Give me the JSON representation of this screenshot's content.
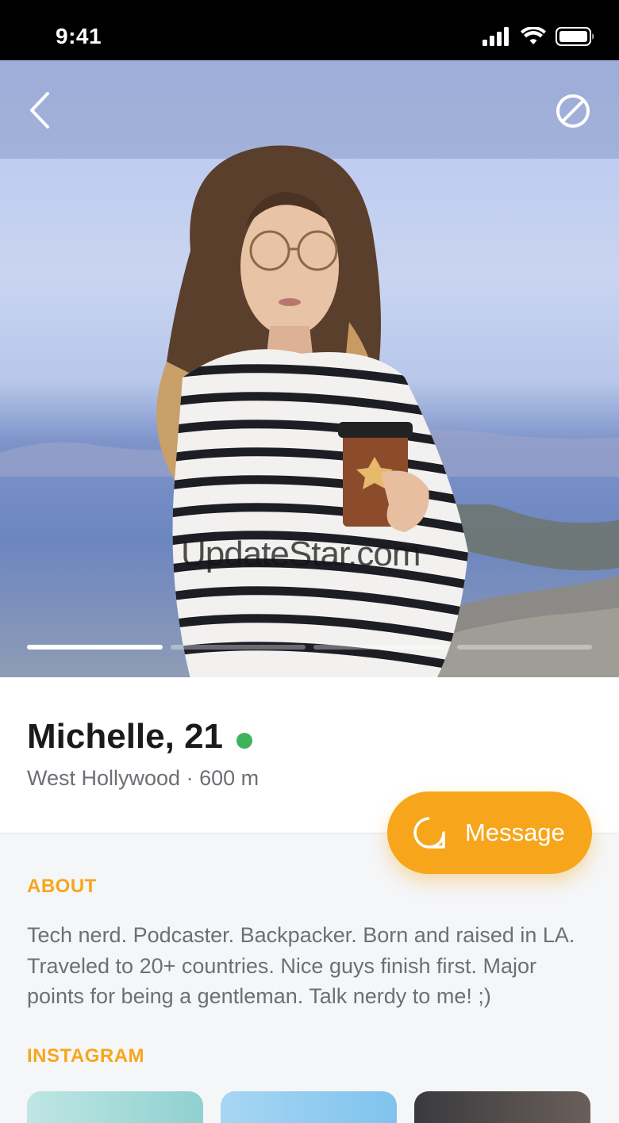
{
  "status_bar": {
    "time": "9:41"
  },
  "photo": {
    "watermark": "UpdateStar.com",
    "page_count": 4,
    "active_page": 1
  },
  "profile": {
    "name": "Michelle, 21",
    "location": "West Hollywood · 600 m",
    "online": true
  },
  "actions": {
    "message_label": "Message"
  },
  "about": {
    "title": "ABOUT",
    "text": "Tech nerd. Podcaster. Backpacker. Born and raised in LA. Traveled to 20+ countries. Nice guys finish first. Major points for being a gentleman. Talk nerdy to me! ;)"
  },
  "instagram": {
    "title": "INSTAGRAM",
    "thumb_count": 3
  },
  "colors": {
    "accent": "#f7a61b",
    "online": "#3db35b",
    "text_primary": "#1b1b1d",
    "text_secondary": "#6d6f75"
  }
}
